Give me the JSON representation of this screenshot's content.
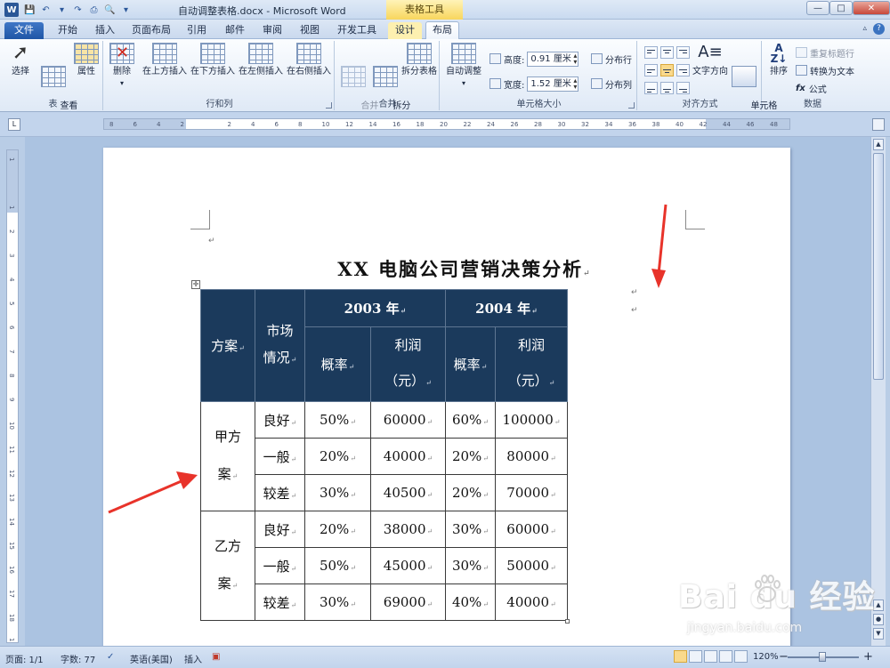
{
  "window": {
    "title": "自动调整表格.docx - Microsoft Word",
    "context_tab": "表格工具",
    "minimize": "—",
    "restore": "□",
    "close": "✕"
  },
  "qat": {
    "save": "💾",
    "undo": "↶",
    "redo": "↷",
    "print": "⎙",
    "preview": "🔍",
    "customize": "▾"
  },
  "tabs": [
    {
      "label": "文件"
    },
    {
      "label": "开始"
    },
    {
      "label": "插入"
    },
    {
      "label": "页面布局"
    },
    {
      "label": "引用"
    },
    {
      "label": "邮件"
    },
    {
      "label": "审阅"
    },
    {
      "label": "视图"
    },
    {
      "label": "开发工具"
    },
    {
      "label": "设计"
    },
    {
      "label": "布局"
    }
  ],
  "ribbon": {
    "table": {
      "label": "表",
      "select": "选择",
      "view_grid": "查看\n网格线",
      "properties": "属性"
    },
    "rows_cols": {
      "label": "行和列",
      "delete": "删除",
      "insert_above": "在上方插入",
      "insert_below": "在下方插入",
      "insert_left": "在左侧插入",
      "insert_right": "在右侧插入"
    },
    "merge": {
      "label": "合并",
      "merge_cells": "合并\n单元格",
      "split_cells": "拆分\n单元格",
      "split_table": "拆分表格"
    },
    "cell_size": {
      "label": "单元格大小",
      "autofit": "自动调整",
      "height_label": "高度:",
      "height_value": "0.91 厘米",
      "width_label": "宽度:",
      "width_value": "1.52 厘米",
      "distribute_rows": "分布行",
      "distribute_cols": "分布列"
    },
    "alignment": {
      "label": "对齐方式",
      "text_direction": "文字方向",
      "cell_margins": "单元格\n边距"
    },
    "data": {
      "label": "数据",
      "sort": "排序",
      "repeat_header": "重复标题行",
      "convert_text": "转换为文本",
      "formula": "公式"
    }
  },
  "ruler": {
    "h_ticks": [
      "8",
      "6",
      "4",
      "2",
      "",
      "2",
      "4",
      "6",
      "8",
      "10",
      "12",
      "14",
      "16",
      "18",
      "20",
      "22",
      "24",
      "26",
      "28",
      "30",
      "32",
      "34",
      "36",
      "38",
      "40",
      "42",
      "44",
      "46",
      "48"
    ],
    "v_ticks": [
      "1",
      "",
      "1",
      "2",
      "3",
      "4",
      "5",
      "6",
      "7",
      "8",
      "9",
      "10",
      "11",
      "12",
      "13",
      "14",
      "15",
      "16",
      "17",
      "18",
      "19"
    ]
  },
  "document": {
    "heading": "XX 电脑公司营销决策分析",
    "para_mark": "↵",
    "table": {
      "header": {
        "scheme": "方案",
        "market": "市场\n情况",
        "year1": "2003 年",
        "year2": "2004 年",
        "prob": "概率",
        "profit": "利润\n（元）"
      },
      "groups": [
        {
          "name": "甲方\n案",
          "rows": [
            {
              "market": "良好",
              "p1": "50%",
              "v1": "60000",
              "p2": "60%",
              "v2": "100000"
            },
            {
              "market": "一般",
              "p1": "20%",
              "v1": "40000",
              "p2": "20%",
              "v2": "80000"
            },
            {
              "market": "较差",
              "p1": "30%",
              "v1": "40500",
              "p2": "20%",
              "v2": "70000"
            }
          ]
        },
        {
          "name": "乙方\n案",
          "rows": [
            {
              "market": "良好",
              "p1": "20%",
              "v1": "38000",
              "p2": "30%",
              "v2": "60000"
            },
            {
              "market": "一般",
              "p1": "50%",
              "v1": "45000",
              "p2": "30%",
              "v2": "50000"
            },
            {
              "market": "较差",
              "p1": "30%",
              "v1": "69000",
              "p2": "40%",
              "v2": "40000"
            }
          ]
        }
      ]
    }
  },
  "status": {
    "page": "页面: 1/1",
    "words": "字数: 77",
    "language": "英语(美国)",
    "mode": "插入",
    "zoom": "120%",
    "zoom_minus": "−",
    "zoom_plus": "+"
  },
  "watermark": {
    "brand": "Bai  du 经验",
    "url": "jingyan.baidu.com"
  },
  "colors": {
    "header_fill": "#1b3a5c",
    "arrow": "#e8332a",
    "accent": "#2b579a"
  }
}
